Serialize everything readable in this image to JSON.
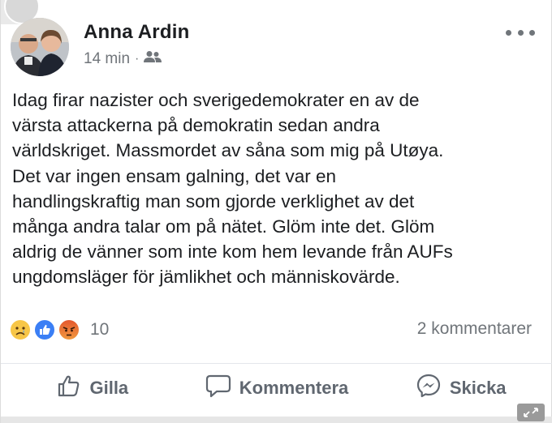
{
  "post": {
    "author": "Anna Ardin",
    "time": "14 min",
    "separator": "·",
    "audience_icon": "friends-icon",
    "more_icon": "more-options-icon",
    "text": "Idag firar nazister och sverigedemokrater en av de\nvärsta attackerna på demokratin sedan andra\nvärldskriget. Massmordet av såna som mig på Utøya.\nDet var ingen ensam galning, det var en\nhandlingskraftig man som gjorde verklighet av det\nmånga andra talar om på nätet. Glöm inte det. Glöm\naldrig de vänner som inte kom hem levande från AUFs\nungdomsläger för jämlikhet och människovärde."
  },
  "reactions": {
    "icons": [
      "sad-reaction-icon",
      "like-reaction-icon",
      "angry-reaction-icon"
    ],
    "count": "10",
    "comments": "2 kommentarer"
  },
  "actions": [
    {
      "label": "Gilla",
      "icon": "thumbs-up-icon"
    },
    {
      "label": "Kommentera",
      "icon": "comment-icon"
    },
    {
      "label": "Skicka",
      "icon": "messenger-icon"
    }
  ],
  "colors": {
    "text": "#1c1e21",
    "secondary": "#70757a",
    "like_blue": "#3b7ff5",
    "sad_yellow": "#f7c647",
    "angry_orange": "#e4572e"
  }
}
